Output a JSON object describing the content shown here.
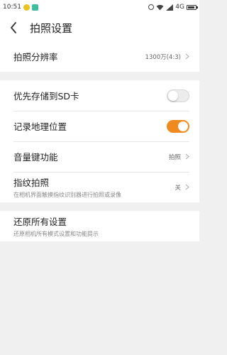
{
  "status_bar": {
    "time": "10:51",
    "network": "4G",
    "icons": [
      "app-notification-icon",
      "app-notification-icon",
      "alarm-icon",
      "wifi-icon",
      "signal-icon",
      "battery-icon"
    ]
  },
  "header": {
    "back_icon": "back-arrow-icon",
    "title": "拍照设置"
  },
  "group1": {
    "resolution": {
      "label": "拍照分辨率",
      "value": "1300万(4:3)"
    }
  },
  "group2": {
    "sd_card": {
      "label": "优先存储到SD卡",
      "enabled": false
    },
    "location": {
      "label": "记录地理位置",
      "enabled": true
    },
    "volume_key": {
      "label": "音量键功能",
      "value": "拍照"
    },
    "fingerprint": {
      "label": "指纹拍照",
      "description": "在相机界面触摸指纹识别器进行拍照或录像",
      "value": "关"
    }
  },
  "group3": {
    "restore": {
      "label": "还原所有设置",
      "description": "还原相机所有模式设置和功能提示"
    }
  },
  "colors": {
    "accent": "#f08a1e",
    "background": "#f0f0f0",
    "surface": "#ffffff"
  }
}
